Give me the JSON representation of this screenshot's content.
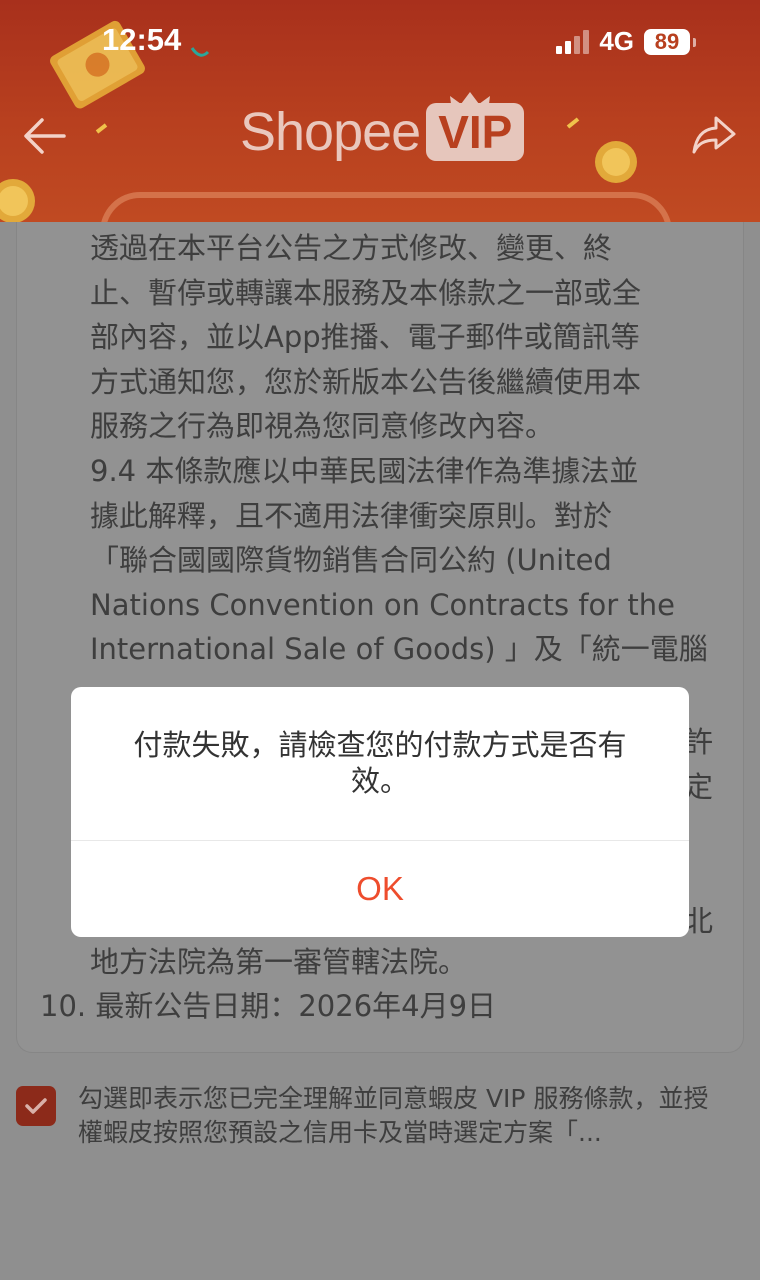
{
  "status_bar": {
    "time": "12:54",
    "network": "4G",
    "battery": "89"
  },
  "header": {
    "logo_text": "Shopee",
    "logo_badge": "VIP"
  },
  "terms": {
    "block1": "透過在本平台公告之方式修改、變更、終\n止、暫停或轉讓本服務及本條款之一部或全\n部內容，並以App推播、電子郵件或簡訊等\n方式通知您，您於新版本公告後繼續使用本\n服務之行為即視為您同意修改內容。",
    "block2": "9.4 本條款應以中華民國法律作為準據法並\n據此解釋，且不適用法律衝突原則。對於\n「聯合國國際貨物銷售合同公約 (United\nNations Convention on Contracts for the\nInternational Sale of Goods) 」及「統一電腦",
    "right_frag_1": "許",
    "right_frag_2": "定",
    "right_frag_3": "北",
    "last_line": "地方法院為第一審管轄法院。",
    "item10": "10. 最新公告日期：2026年4月9日"
  },
  "agreement": {
    "text": "勾選即表示您已完全理解並同意蝦皮 VIP 服務條款，並授權蝦皮按照您預設之信用卡及當時選定方案「..."
  },
  "modal": {
    "message": "付款失敗，請檢查您的付款方式是否有效。",
    "ok_label": "OK"
  },
  "colors": {
    "brand": "#ee4d2d",
    "header": "#b8401f",
    "overlay": "#8f8f8f"
  }
}
